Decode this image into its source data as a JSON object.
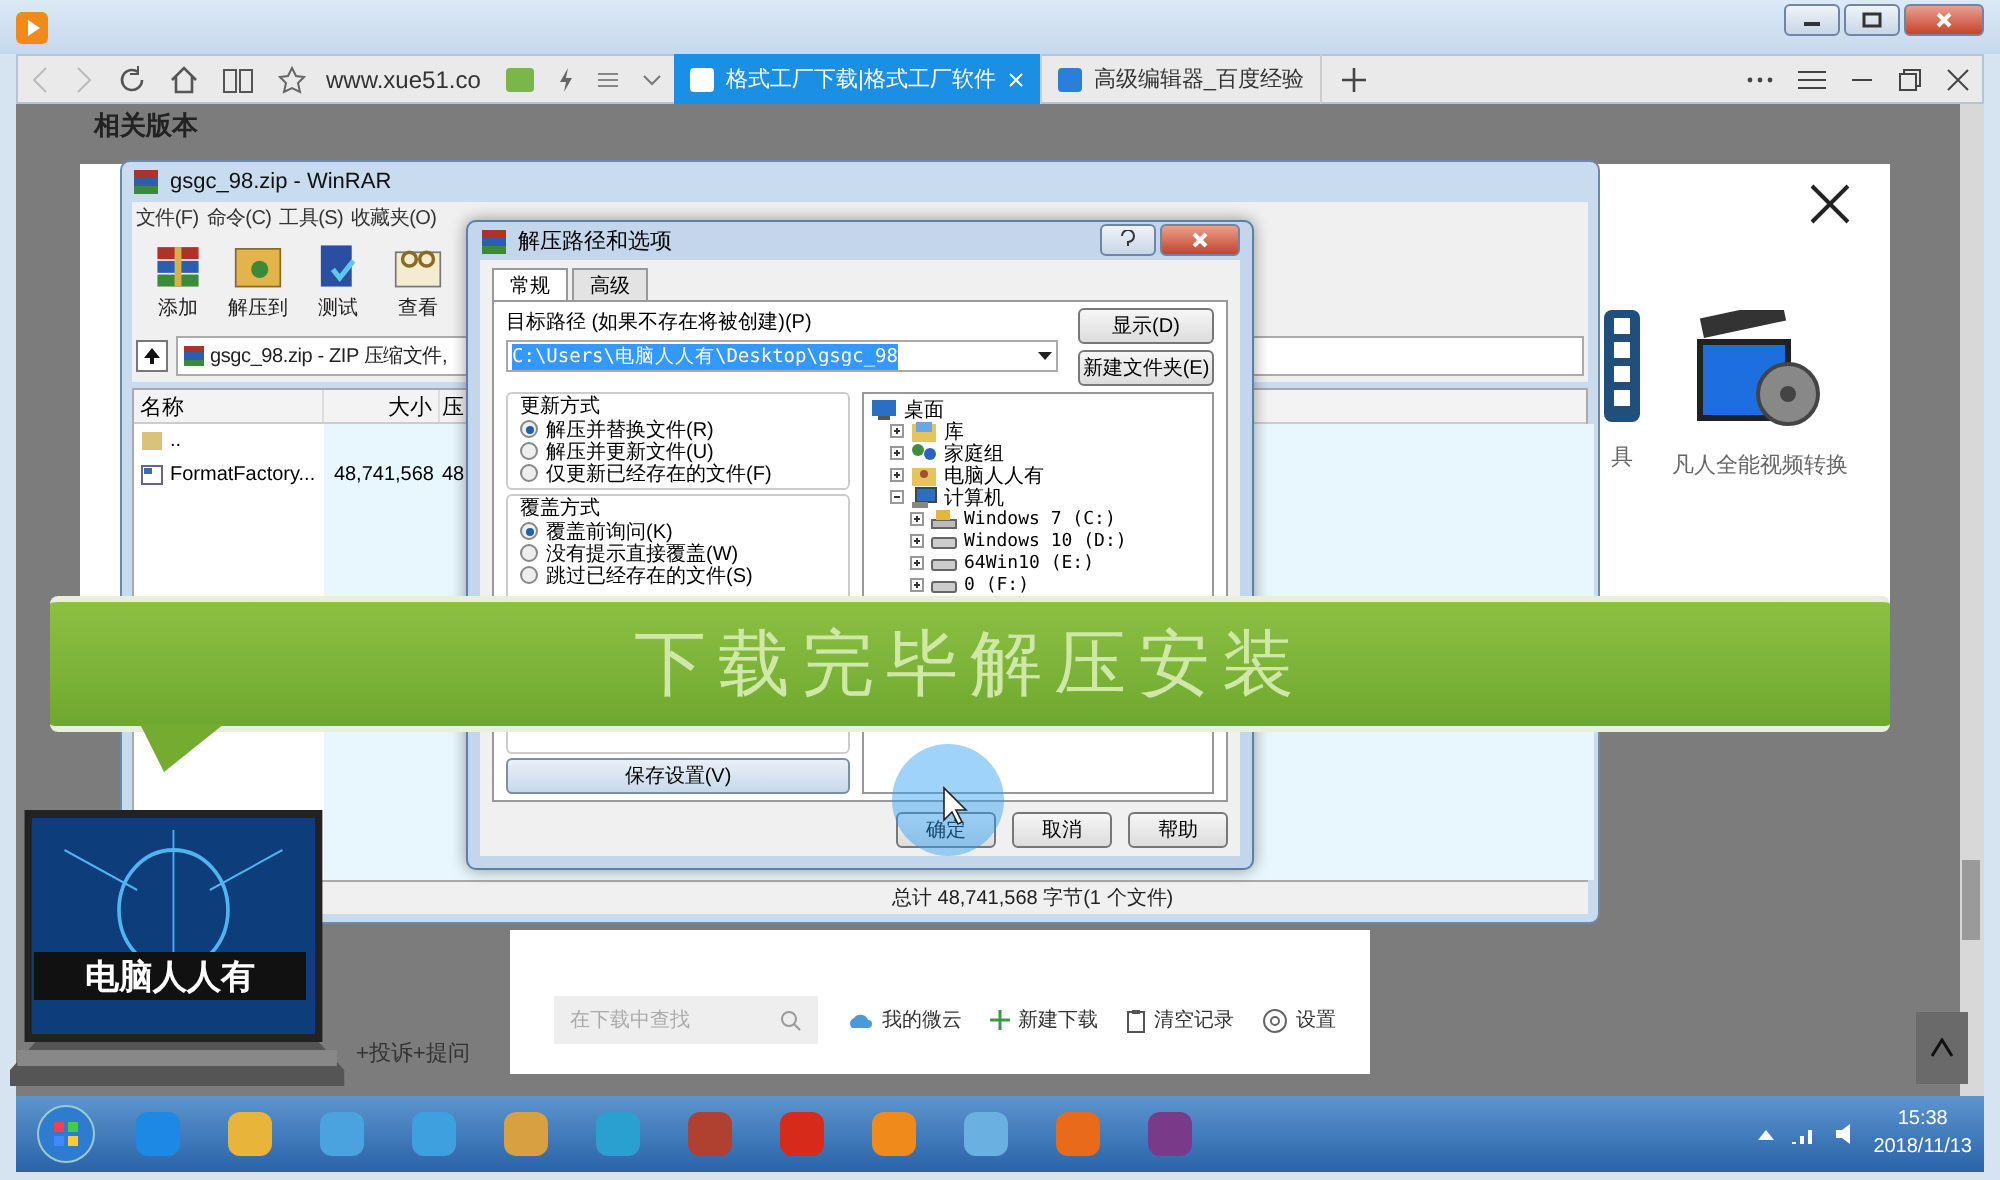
{
  "browser": {
    "tabs": [
      {
        "label": "格式工厂下载|格式工厂软件",
        "selected": true
      },
      {
        "label": "高级编辑器_百度经验",
        "selected": false
      }
    ],
    "address": "www.xue51.co"
  },
  "page": {
    "heading": "相关版本",
    "apps": [
      {
        "label": "具",
        "kind": "film"
      },
      {
        "label": "凡人全能视频转换",
        "kind": "clapper"
      }
    ],
    "report_links": "+投诉+提问"
  },
  "downloads": {
    "search_placeholder": "在下载中查找",
    "actions": [
      {
        "label": "我的微云",
        "kind": "cloud"
      },
      {
        "label": "新建下载",
        "kind": "plus"
      },
      {
        "label": "清空记录",
        "kind": "clipboard"
      },
      {
        "label": "设置",
        "kind": "gear"
      }
    ]
  },
  "winrar": {
    "title": "gsgc_98.zip - WinRAR",
    "menu": [
      "文件(F)",
      "命令(C)",
      "工具(S)",
      "收藏夹(O)"
    ],
    "tools": [
      {
        "label": "添加",
        "kind": "add"
      },
      {
        "label": "解压到",
        "kind": "extract"
      },
      {
        "label": "测试",
        "kind": "test"
      },
      {
        "label": "查看",
        "kind": "view"
      }
    ],
    "path": "gsgc_98.zip - ZIP 压缩文件,",
    "columns": [
      "名称",
      "大小",
      "压"
    ],
    "rows": [
      {
        "kind": "up",
        "name": ".."
      },
      {
        "kind": "file",
        "name": "FormatFactory...",
        "size": "48,741,568",
        "packed": "48,"
      }
    ],
    "status": "总计 48,741,568 字节(1 个文件)"
  },
  "dialog": {
    "title": "解压路径和选项",
    "tabs": [
      {
        "label": "常规",
        "selected": true
      },
      {
        "label": "高级",
        "selected": false
      }
    ],
    "path_label": "目标路径 (如果不存在将被创建)(P)",
    "path_value": "C:\\Users\\电脑人人有\\Desktop\\gsgc_98",
    "side_buttons": [
      "显示(D)",
      "新建文件夹(E)"
    ],
    "groups": [
      {
        "title": "更新方式",
        "options": [
          {
            "label": "解压并替换文件(R)",
            "selected": true
          },
          {
            "label": "解压并更新文件(U)",
            "selected": false
          },
          {
            "label": "仅更新已经存在的文件(F)",
            "selected": false
          }
        ]
      },
      {
        "title": "覆盖方式",
        "options": [
          {
            "label": "覆盖前询问(K)",
            "selected": true
          },
          {
            "label": "没有提示直接覆盖(W)",
            "selected": false
          },
          {
            "label": "跳过已经存在的文件(S)",
            "selected": false
          }
        ]
      }
    ],
    "save_button": "保存设置(V)",
    "tree": [
      {
        "label": "桌面",
        "kind": "desktop",
        "children": [
          {
            "label": "库",
            "kind": "library",
            "expanded": false
          },
          {
            "label": "家庭组",
            "kind": "network",
            "expanded": false
          },
          {
            "label": "电脑人人有",
            "kind": "user",
            "expanded": false
          },
          {
            "label": "计算机",
            "kind": "computer",
            "expanded": true,
            "children": [
              {
                "label": "Windows 7 (C:)",
                "kind": "system-drive",
                "expanded": false
              },
              {
                "label": "Windows 10 (D:)",
                "kind": "drive",
                "expanded": false
              },
              {
                "label": "64Win10 (E:)",
                "kind": "drive",
                "expanded": false
              },
              {
                "label": "0 (F:)",
                "kind": "drive",
                "expanded": false
              }
            ]
          }
        ]
      }
    ],
    "buttons": [
      "确定",
      "取消",
      "帮助"
    ]
  },
  "banner": "下载完毕解压安装",
  "logo": "电脑人人有",
  "taskbar": {
    "time": "15:38",
    "date": "2018/11/13"
  }
}
